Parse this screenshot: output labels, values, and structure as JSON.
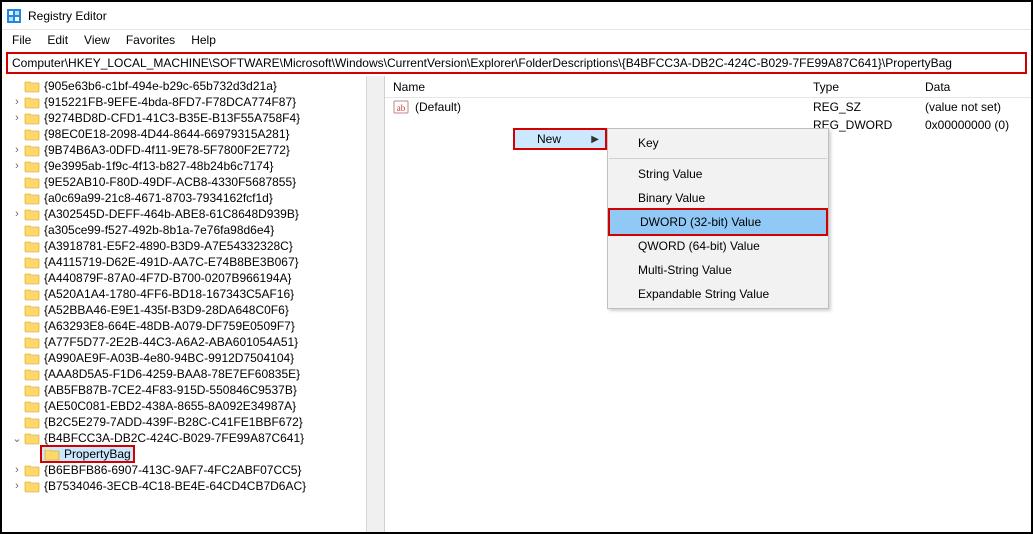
{
  "window": {
    "title": "Registry Editor"
  },
  "menubar": {
    "items": [
      "File",
      "Edit",
      "View",
      "Favorites",
      "Help"
    ]
  },
  "addressbar": {
    "value": "Computer\\HKEY_LOCAL_MACHINE\\SOFTWARE\\Microsoft\\Windows\\CurrentVersion\\Explorer\\FolderDescriptions\\{B4BFCC3A-DB2C-424C-B029-7FE99A87C641}\\PropertyBag"
  },
  "tree": {
    "items": [
      {
        "exp": "",
        "label": "{905e63b6-c1bf-494e-b29c-65b732d3d21a}"
      },
      {
        "exp": ">",
        "label": "{915221FB-9EFE-4bda-8FD7-F78DCA774F87}"
      },
      {
        "exp": ">",
        "label": "{9274BD8D-CFD1-41C3-B35E-B13F55A758F4}"
      },
      {
        "exp": "",
        "label": "{98EC0E18-2098-4D44-8644-66979315A281}"
      },
      {
        "exp": ">",
        "label": "{9B74B6A3-0DFD-4f11-9E78-5F7800F2E772}"
      },
      {
        "exp": ">",
        "label": "{9e3995ab-1f9c-4f13-b827-48b24b6c7174}"
      },
      {
        "exp": "",
        "label": "{9E52AB10-F80D-49DF-ACB8-4330F5687855}"
      },
      {
        "exp": "",
        "label": "{a0c69a99-21c8-4671-8703-7934162fcf1d}"
      },
      {
        "exp": ">",
        "label": "{A302545D-DEFF-464b-ABE8-61C8648D939B}"
      },
      {
        "exp": "",
        "label": "{a305ce99-f527-492b-8b1a-7e76fa98d6e4}"
      },
      {
        "exp": "",
        "label": "{A3918781-E5F2-4890-B3D9-A7E54332328C}"
      },
      {
        "exp": "",
        "label": "{A4115719-D62E-491D-AA7C-E74B8BE3B067}"
      },
      {
        "exp": "",
        "label": "{A440879F-87A0-4F7D-B700-0207B966194A}"
      },
      {
        "exp": "",
        "label": "{A520A1A4-1780-4FF6-BD18-167343C5AF16}"
      },
      {
        "exp": "",
        "label": "{A52BBA46-E9E1-435f-B3D9-28DA648C0F6}"
      },
      {
        "exp": "",
        "label": "{A63293E8-664E-48DB-A079-DF759E0509F7}"
      },
      {
        "exp": "",
        "label": "{A77F5D77-2E2B-44C3-A6A2-ABA601054A51}"
      },
      {
        "exp": "",
        "label": "{A990AE9F-A03B-4e80-94BC-9912D7504104}"
      },
      {
        "exp": "",
        "label": "{AAA8D5A5-F1D6-4259-BAA8-78E7EF60835E}"
      },
      {
        "exp": "",
        "label": "{AB5FB87B-7CE2-4F83-915D-550846C9537B}"
      },
      {
        "exp": "",
        "label": "{AE50C081-EBD2-438A-8655-8A092E34987A}"
      },
      {
        "exp": "",
        "label": "{B2C5E279-7ADD-439F-B28C-C41FE1BBF672}"
      },
      {
        "exp": "v",
        "label": "{B4BFCC3A-DB2C-424C-B029-7FE99A87C641}"
      }
    ],
    "selected_child": "PropertyBag",
    "after": [
      {
        "exp": ">",
        "label": "{B6EBFB86-6907-413C-9AF7-4FC2ABF07CC5}"
      },
      {
        "exp": ">",
        "label": "{B7534046-3ECB-4C18-BE4E-64CD4CB7D6AC}"
      }
    ]
  },
  "list": {
    "columns": {
      "name": "Name",
      "type": "Type",
      "data": "Data"
    },
    "rows": [
      {
        "icon": "ab",
        "name": "(Default)",
        "type": "REG_SZ",
        "data": "(value not set)"
      },
      {
        "icon": "",
        "name": "",
        "type": "REG_DWORD",
        "data": "0x00000000 (0)"
      }
    ]
  },
  "context": {
    "new_label": "New",
    "sub": {
      "items_top": [
        "Key"
      ],
      "items_bottom": [
        "String Value",
        "Binary Value",
        "DWORD (32-bit) Value",
        "QWORD (64-bit) Value",
        "Multi-String Value",
        "Expandable String Value"
      ],
      "highlight_index": 2
    }
  }
}
